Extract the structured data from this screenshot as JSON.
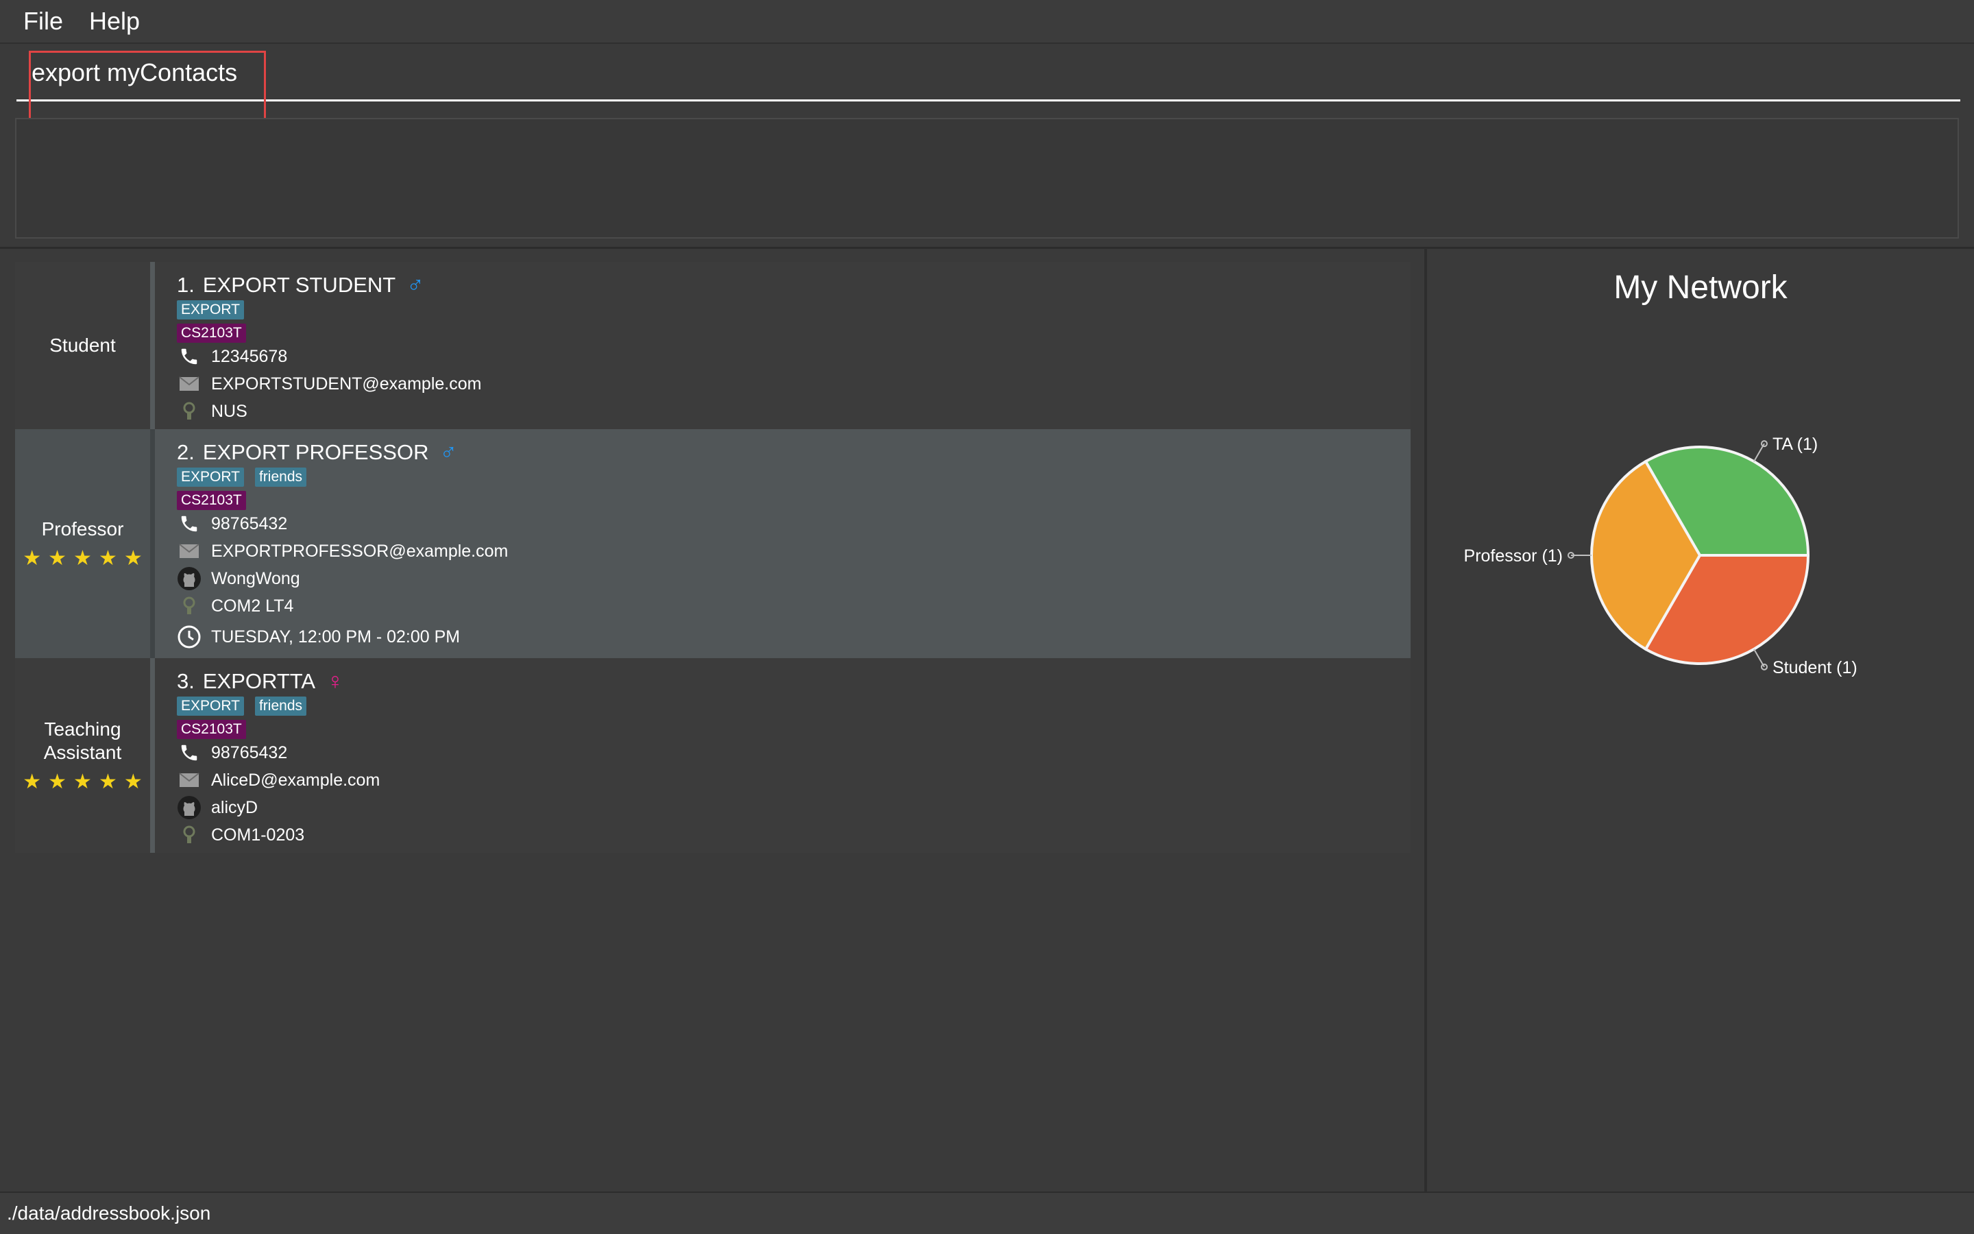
{
  "menu": {
    "file_label": "File",
    "help_label": "Help"
  },
  "command": {
    "value": "export myContacts"
  },
  "persons": [
    {
      "role": "Student",
      "stars": 0,
      "index": "1.",
      "name": "EXPORT STUDENT",
      "gender": "male",
      "tags": [
        "EXPORT"
      ],
      "module": "CS2103T",
      "phone": "12345678",
      "email": "EXPORTSTUDENT@example.com",
      "location": "NUS"
    },
    {
      "role": "Professor",
      "stars": 5,
      "index": "2.",
      "name": "EXPORT PROFESSOR",
      "gender": "male",
      "tags": [
        "EXPORT",
        "friends"
      ],
      "module": "CS2103T",
      "phone": "98765432",
      "email": "EXPORTPROFESSOR@example.com",
      "github": "WongWong",
      "location": "COM2 LT4",
      "timeslot": "TUESDAY, 12:00 PM - 02:00 PM"
    },
    {
      "role_line1": "Teaching",
      "role_line2": "Assistant",
      "stars": 5,
      "index": "3.",
      "name": "EXPORTTA",
      "gender": "female",
      "tags": [
        "EXPORT",
        "friends"
      ],
      "module": "CS2103T",
      "phone": "98765432",
      "email": "AliceD@example.com",
      "github": "alicyD",
      "location": "COM1-0203"
    }
  ],
  "network": {
    "title": "My Network"
  },
  "chart_data": {
    "type": "pie",
    "title": "My Network",
    "slices": [
      {
        "label": "TA (1)",
        "value": 1,
        "color": "#5cb85c"
      },
      {
        "label": "Student (1)",
        "value": 1,
        "color": "#e8643a"
      },
      {
        "label": "Professor (1)",
        "value": 1,
        "color": "#f0a030"
      }
    ]
  },
  "status": {
    "path": "./data/addressbook.json"
  },
  "colors": {
    "accent_red": "#e04444",
    "tag_blue": "#3e7b91",
    "tag_purple": "#6a0f5a",
    "star": "#f5d21a"
  }
}
